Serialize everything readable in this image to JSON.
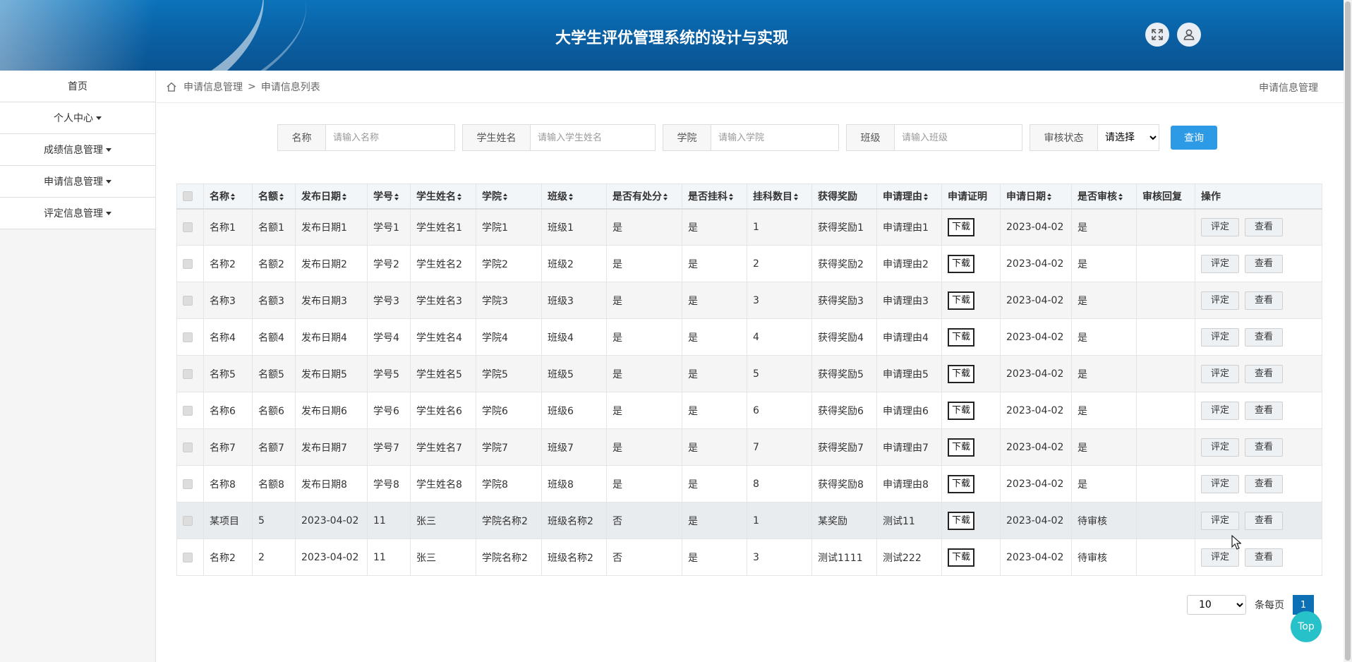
{
  "header": {
    "title": "大学生评优管理系统的设计与实现"
  },
  "sidebar": {
    "items": [
      {
        "label": "首页",
        "dropdown": false
      },
      {
        "label": "个人中心",
        "dropdown": true
      },
      {
        "label": "成绩信息管理",
        "dropdown": true
      },
      {
        "label": "申请信息管理",
        "dropdown": true
      },
      {
        "label": "评定信息管理",
        "dropdown": true
      }
    ]
  },
  "breadcrumb": {
    "items": [
      "申请信息管理",
      "申请信息列表"
    ],
    "separator": ">",
    "right": "申请信息管理"
  },
  "search": {
    "fields": [
      {
        "label": "名称",
        "placeholder": "请输入名称"
      },
      {
        "label": "学生姓名",
        "placeholder": "请输入学生姓名"
      },
      {
        "label": "学院",
        "placeholder": "请输入学院"
      },
      {
        "label": "班级",
        "placeholder": "请输入班级"
      }
    ],
    "status": {
      "label": "审核状态",
      "value": "请选择"
    },
    "query_label": "查询"
  },
  "table": {
    "columns": [
      {
        "label": "名称",
        "sortable": true
      },
      {
        "label": "名额",
        "sortable": true
      },
      {
        "label": "发布日期",
        "sortable": true
      },
      {
        "label": "学号",
        "sortable": true
      },
      {
        "label": "学生姓名",
        "sortable": true
      },
      {
        "label": "学院",
        "sortable": true
      },
      {
        "label": "班级",
        "sortable": true
      },
      {
        "label": "是否有处分",
        "sortable": true
      },
      {
        "label": "是否挂科",
        "sortable": true
      },
      {
        "label": "挂科数目",
        "sortable": true
      },
      {
        "label": "获得奖励",
        "sortable": false
      },
      {
        "label": "申请理由",
        "sortable": true
      },
      {
        "label": "申请证明",
        "sortable": false
      },
      {
        "label": "申请日期",
        "sortable": true
      },
      {
        "label": "是否审核",
        "sortable": true
      },
      {
        "label": "审核回复",
        "sortable": false
      },
      {
        "label": "操作",
        "sortable": false
      }
    ],
    "download_label": "下载",
    "action_labels": [
      "评定",
      "查看"
    ],
    "rows": [
      [
        "名称1",
        "名额1",
        "发布日期1",
        "学号1",
        "学生姓名1",
        "学院1",
        "班级1",
        "是",
        "是",
        "1",
        "获得奖励1",
        "申请理由1",
        "2023-04-02",
        "是",
        ""
      ],
      [
        "名称2",
        "名额2",
        "发布日期2",
        "学号2",
        "学生姓名2",
        "学院2",
        "班级2",
        "是",
        "是",
        "2",
        "获得奖励2",
        "申请理由2",
        "2023-04-02",
        "是",
        ""
      ],
      [
        "名称3",
        "名额3",
        "发布日期3",
        "学号3",
        "学生姓名3",
        "学院3",
        "班级3",
        "是",
        "是",
        "3",
        "获得奖励3",
        "申请理由3",
        "2023-04-02",
        "是",
        ""
      ],
      [
        "名称4",
        "名额4",
        "发布日期4",
        "学号4",
        "学生姓名4",
        "学院4",
        "班级4",
        "是",
        "是",
        "4",
        "获得奖励4",
        "申请理由4",
        "2023-04-02",
        "是",
        ""
      ],
      [
        "名称5",
        "名额5",
        "发布日期5",
        "学号5",
        "学生姓名5",
        "学院5",
        "班级5",
        "是",
        "是",
        "5",
        "获得奖励5",
        "申请理由5",
        "2023-04-02",
        "是",
        ""
      ],
      [
        "名称6",
        "名额6",
        "发布日期6",
        "学号6",
        "学生姓名6",
        "学院6",
        "班级6",
        "是",
        "是",
        "6",
        "获得奖励6",
        "申请理由6",
        "2023-04-02",
        "是",
        ""
      ],
      [
        "名称7",
        "名额7",
        "发布日期7",
        "学号7",
        "学生姓名7",
        "学院7",
        "班级7",
        "是",
        "是",
        "7",
        "获得奖励7",
        "申请理由7",
        "2023-04-02",
        "是",
        ""
      ],
      [
        "名称8",
        "名额8",
        "发布日期8",
        "学号8",
        "学生姓名8",
        "学院8",
        "班级8",
        "是",
        "是",
        "8",
        "获得奖励8",
        "申请理由8",
        "2023-04-02",
        "是",
        ""
      ],
      [
        "某项目",
        "5",
        "2023-04-02",
        "11",
        "张三",
        "学院名称2",
        "班级名称2",
        "否",
        "是",
        "1",
        "某奖励",
        "测试11",
        "2023-04-02",
        "待审核",
        ""
      ],
      [
        "名称2",
        "2",
        "2023-04-02",
        "11",
        "张三",
        "学院名称2",
        "班级名称2",
        "否",
        "是",
        "3",
        "测试1111",
        "测试222",
        "2023-04-02",
        "待审核",
        ""
      ]
    ],
    "highlight_row": 8
  },
  "pagination": {
    "page_size": "10",
    "per_page_label": "条每页",
    "current_page": "1"
  },
  "top_button": "Top",
  "colors": {
    "header": "#0a60a5",
    "primary": "#2d9ae6",
    "page_active": "#0d6fb4",
    "top_button": "#26c1c9"
  }
}
